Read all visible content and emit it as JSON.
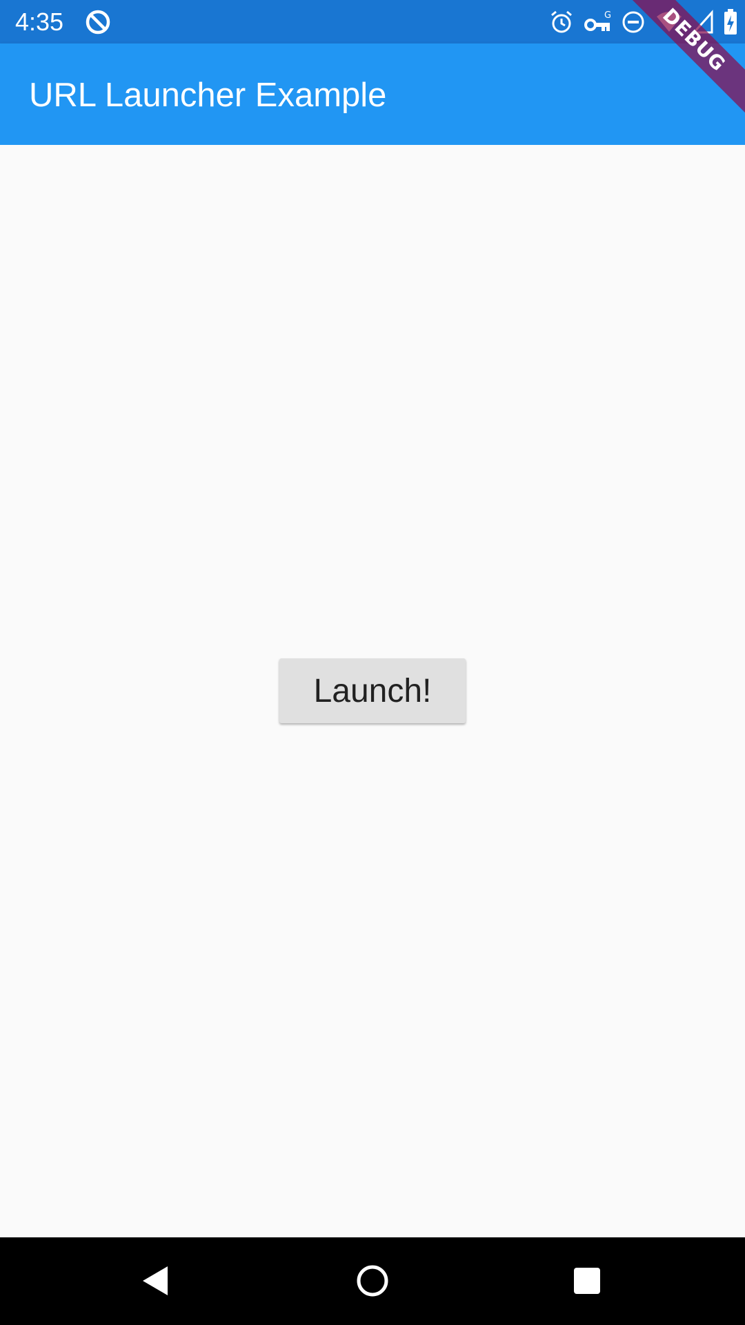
{
  "status_bar": {
    "time": "4:35",
    "left_icons": [
      "data-saver-icon"
    ],
    "right_icons": [
      "alarm-icon",
      "vpn-key-icon",
      "do-not-disturb-icon",
      "wifi-icon",
      "signal-icon",
      "battery-charging-icon"
    ],
    "color": "#1976d2"
  },
  "app_bar": {
    "title": "URL Launcher Example",
    "color": "#2196f3"
  },
  "debug_banner": {
    "label": "DEBUG"
  },
  "main": {
    "launch_button_label": "Launch!"
  },
  "nav_bar": {
    "buttons": [
      "back-icon",
      "home-icon",
      "recents-icon"
    ]
  }
}
